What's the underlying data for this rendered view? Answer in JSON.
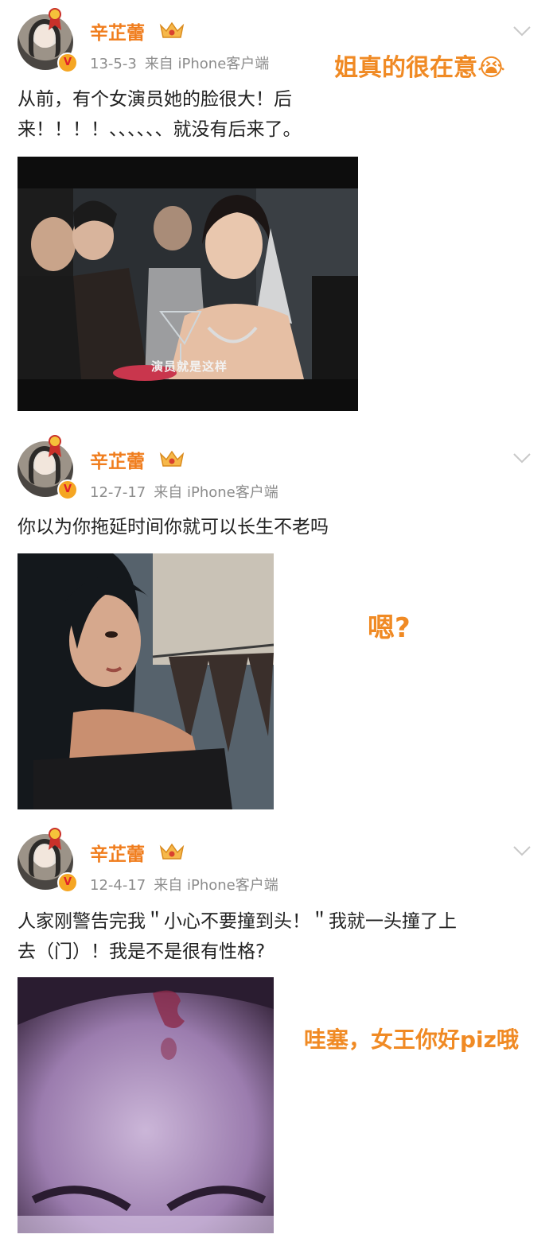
{
  "posts": [
    {
      "user": "辛芷蕾",
      "time": "13-5-3",
      "source": "来自 iPhone客户端",
      "text": "从前，有个女演员她的脸很大！后\n来！！！！、、、、、、就没有后来了。",
      "annotation": "姐真的很在意😭",
      "caption": "演员就是这样"
    },
    {
      "user": "辛芷蕾",
      "time": "12-7-17",
      "source": "来自 iPhone客户端",
      "text": "你以为你拖延时间你就可以长生不老吗",
      "annotation": "嗯?"
    },
    {
      "user": "辛芷蕾",
      "time": "12-4-17",
      "source": "来自 iPhone客户端",
      "text": "人家刚警告完我＂小心不要撞到头！＂我就一头撞了上\n去（门）！我是不是很有性格?",
      "annotation": "哇塞，女王你好piz哦"
    }
  ],
  "colors": {
    "name": "#f07d1d",
    "annotation": "#f08a24",
    "meta": "#8c8c8c"
  },
  "icons": {
    "verified": "v-badge-icon",
    "crown": "crown-icon",
    "more": "chevron-down-icon"
  }
}
